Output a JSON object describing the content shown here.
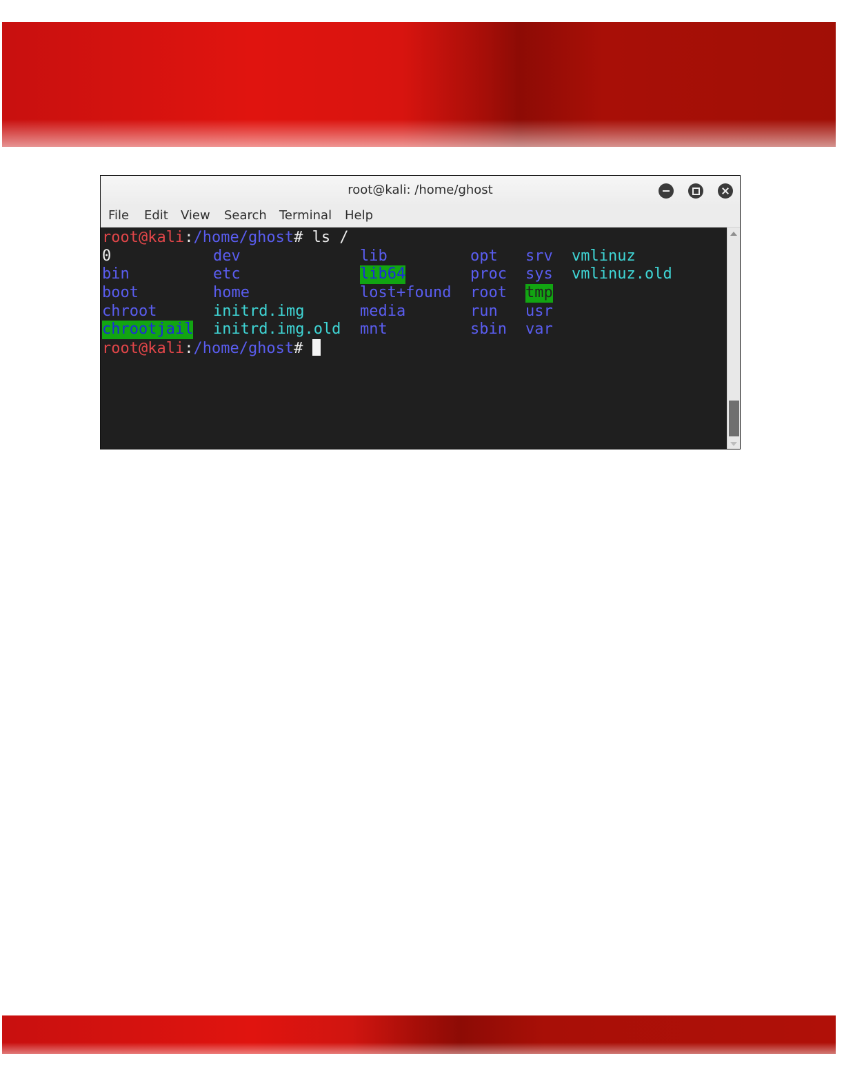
{
  "window": {
    "title": "root@kali: /home/ghost"
  },
  "menu": {
    "file": "File",
    "edit": "Edit",
    "view": "View",
    "search": "Search",
    "terminal": "Terminal",
    "help": "Help"
  },
  "prompt": {
    "user_host": "root@kali",
    "colon": ":",
    "path": "/home/ghost",
    "hash": "#",
    "command": " ls /"
  },
  "listing": {
    "rows": [
      [
        "0",
        "dev",
        "lib",
        "opt",
        "srv",
        "vmlinuz"
      ],
      [
        "bin",
        "etc",
        "lib64",
        "proc",
        "sys",
        "vmlinuz.old"
      ],
      [
        "boot",
        "home",
        "lost+found",
        "root",
        "tmp",
        ""
      ],
      [
        "chroot",
        "initrd.img",
        "media",
        "run",
        "usr",
        ""
      ],
      [
        "chrootjail",
        "initrd.img.old",
        "mnt",
        "sbin",
        "var",
        ""
      ]
    ]
  },
  "colors": {
    "banner_red": "#e0140f",
    "banner_dark": "#8d0b05",
    "terminal_bg": "#1f1f1f",
    "prompt_user": "#e34649",
    "directory_blue": "#5a5df0",
    "symlink_cyan": "#3fd6d6",
    "highlight_green": "#12a512"
  },
  "icons": [
    "minimize-icon",
    "maximize-icon",
    "close-icon",
    "scroll-up-icon",
    "scroll-down-icon"
  ]
}
